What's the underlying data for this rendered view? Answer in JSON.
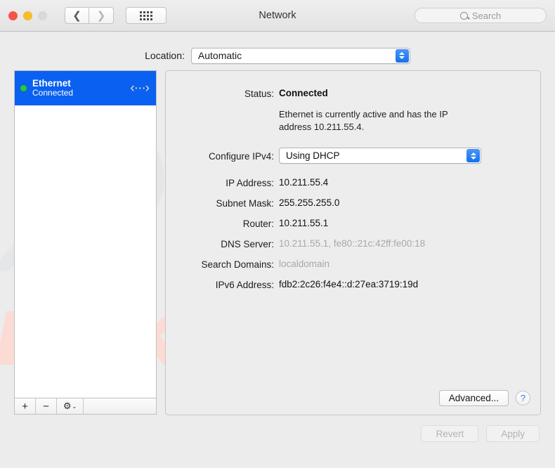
{
  "window": {
    "title": "Network",
    "traffic_lights": [
      "close",
      "minimize",
      "zoom"
    ],
    "back_icon": "chevron-left-icon",
    "forward_icon": "chevron-right-icon",
    "show_all_icon": "grid-dots-icon"
  },
  "search": {
    "placeholder": "Search",
    "icon": "search-icon"
  },
  "location": {
    "label": "Location:",
    "value": "Automatic"
  },
  "services": {
    "items": [
      {
        "name": "Ethernet",
        "status": "Connected",
        "status_color": "#28cc28",
        "icon": "ethernet-icon",
        "icon_glyph": "‹···›",
        "selected": true
      }
    ],
    "toolbar": {
      "add_label": "+",
      "remove_label": "−",
      "gear_label": "⚙",
      "caret_label": "⌄"
    }
  },
  "detail": {
    "status": {
      "key": "Status:",
      "value": "Connected",
      "description": "Ethernet is currently active and has the IP address 10.211.55.4."
    },
    "configure": {
      "key": "Configure IPv4:",
      "value": "Using DHCP"
    },
    "fields": [
      {
        "key": "IP Address:",
        "value": "10.211.55.4",
        "dim": false
      },
      {
        "key": "Subnet Mask:",
        "value": "255.255.255.0",
        "dim": false
      },
      {
        "key": "Router:",
        "value": "10.211.55.1",
        "dim": false
      },
      {
        "key": "DNS Server:",
        "value": "10.211.55.1, fe80::21c:42ff:fe00:18",
        "dim": true
      },
      {
        "key": "Search Domains:",
        "value": "localdomain",
        "dim": true
      },
      {
        "key": "IPv6 Address:",
        "value": "fdb2:2c26:f4e4::d:27ea:3719:19d",
        "dim": false
      }
    ],
    "advanced_label": "Advanced...",
    "help_label": "?"
  },
  "actions": {
    "revert_label": "Revert",
    "apply_label": "Apply"
  },
  "watermark": {
    "top_text": "PC",
    "bottom_text": "risk.com",
    "glass_icon": "magnifier-icon",
    "gray": "#e2e2e2",
    "red": "#fbdbd3"
  },
  "colors": {
    "selection_blue": "#0a60f0",
    "stepper_blue": "#1272ef",
    "window_bg": "#ececec",
    "panel_bg": "#ededed",
    "help_blue": "#2f78e8"
  }
}
